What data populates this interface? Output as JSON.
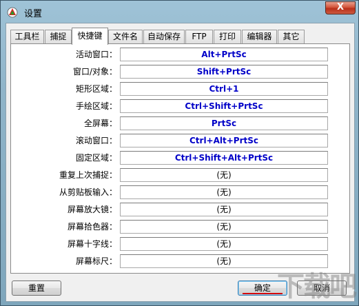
{
  "window": {
    "title": "设置",
    "close_label": "X"
  },
  "tabs": [
    {
      "label": "工具栏",
      "active": false
    },
    {
      "label": "捕捉",
      "active": false
    },
    {
      "label": "快捷键",
      "active": true
    },
    {
      "label": "文件名",
      "active": false
    },
    {
      "label": "自动保存",
      "active": false
    },
    {
      "label": "FTP",
      "active": false
    },
    {
      "label": "打印",
      "active": false
    },
    {
      "label": "编辑器",
      "active": false
    },
    {
      "label": "其它",
      "active": false
    }
  ],
  "hotkeys": [
    {
      "label": "活动窗口：",
      "value": "Alt+PrtSc"
    },
    {
      "label": "窗口/对象：",
      "value": "Shift+PrtSc"
    },
    {
      "label": "矩形区域：",
      "value": "Ctrl+1"
    },
    {
      "label": "手绘区域：",
      "value": "Ctrl+Shift+PrtSc"
    },
    {
      "label": "全屏幕：",
      "value": "PrtSc"
    },
    {
      "label": "滚动窗口：",
      "value": "Ctrl+Alt+PrtSc"
    },
    {
      "label": "固定区域：",
      "value": "Ctrl+Shift+Alt+PrtSc"
    },
    {
      "label": "重复上次捕捉：",
      "value": "(无)"
    },
    {
      "label": "从剪贴板输入：",
      "value": "(无)"
    },
    {
      "label": "屏幕放大镜：",
      "value": "(无)"
    },
    {
      "label": "屏幕拾色器：",
      "value": "(无)"
    },
    {
      "label": "屏幕十字线：",
      "value": "(无)"
    },
    {
      "label": "屏幕标尺：",
      "value": "(无)"
    }
  ],
  "buttons": {
    "reset": "重置",
    "ok": "确定",
    "cancel": "取消"
  },
  "watermark": "下载吧",
  "colors": {
    "hotkey_set": "#0000c8",
    "close": "#c7432a"
  }
}
